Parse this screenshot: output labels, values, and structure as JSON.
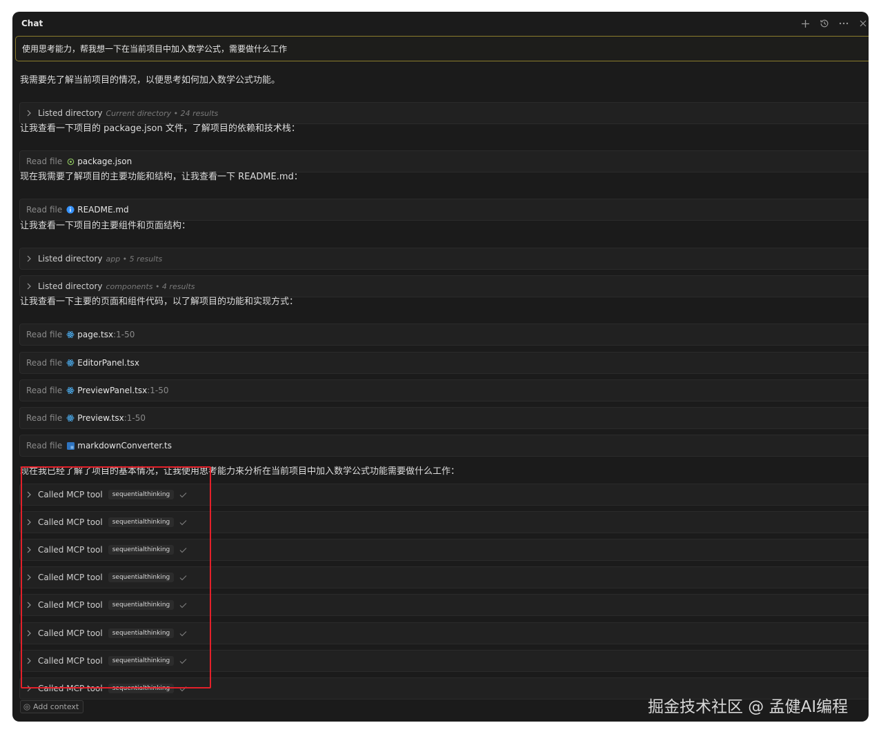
{
  "window": {
    "title": "Chat"
  },
  "toolbar": {
    "icons": [
      "plus-icon",
      "history-icon",
      "more-icon",
      "close-icon"
    ]
  },
  "user_message": "使用思考能力，帮我想一下在当前项目中加入数学公式，需要做什么工作",
  "messages": {
    "m1": "我需要先了解当前项目的情况，以便思考如何加入数学公式功能。",
    "m2": "让我查看一下项目的 package.json 文件，了解项目的依赖和技术栈：",
    "m3": "现在我需要了解项目的主要功能和结构，让我查看一下 README.md：",
    "m4": "让我查看一下项目的主要组件和页面结构：",
    "m5": "让我查看一下主要的页面和组件代码，以了解项目的功能和实现方式：",
    "m6": "现在我已经了解了项目的基本情况，让我使用思考能力来分析在当前项目中加入数学公式功能需要做什么工作："
  },
  "dir1": {
    "action": "Listed directory",
    "meta": "Current directory • 24 results"
  },
  "dir2": {
    "action": "Listed directory",
    "meta": "app • 5 results"
  },
  "dir3": {
    "action": "Listed directory",
    "meta": "components • 4 results"
  },
  "read_label": "Read file",
  "files": [
    {
      "name": "package.json",
      "range": "",
      "icon": "json-icon"
    },
    {
      "name": "README.md",
      "range": "",
      "icon": "info-icon"
    },
    {
      "name": "page.tsx",
      "range": ":1-50",
      "icon": "react-icon"
    },
    {
      "name": "EditorPanel.tsx",
      "range": "",
      "icon": "react-icon"
    },
    {
      "name": "PreviewPanel.tsx",
      "range": ":1-50",
      "icon": "react-icon"
    },
    {
      "name": "Preview.tsx",
      "range": ":1-50",
      "icon": "react-icon"
    },
    {
      "name": "markdownConverter.ts",
      "range": "",
      "icon": "typescript-icon"
    }
  ],
  "mcp_calls": [
    {
      "action": "Called MCP tool",
      "tool": "sequentialthinking"
    },
    {
      "action": "Called MCP tool",
      "tool": "sequentialthinking"
    },
    {
      "action": "Called MCP tool",
      "tool": "sequentialthinking"
    },
    {
      "action": "Called MCP tool",
      "tool": "sequentialthinking"
    },
    {
      "action": "Called MCP tool",
      "tool": "sequentialthinking"
    },
    {
      "action": "Called MCP tool",
      "tool": "sequentialthinking"
    },
    {
      "action": "Called MCP tool",
      "tool": "sequentialthinking"
    },
    {
      "action": "Called MCP tool",
      "tool": "sequentialthinking"
    }
  ],
  "add_context": "Add context",
  "watermark": "掘金技术社区 @ 孟健AI编程",
  "colors": {
    "highlight": "#e5202a",
    "user_border": "#8c7d2e",
    "react": "#4aa8e8",
    "typescript": "#2f74c0",
    "info": "#3794ff"
  }
}
